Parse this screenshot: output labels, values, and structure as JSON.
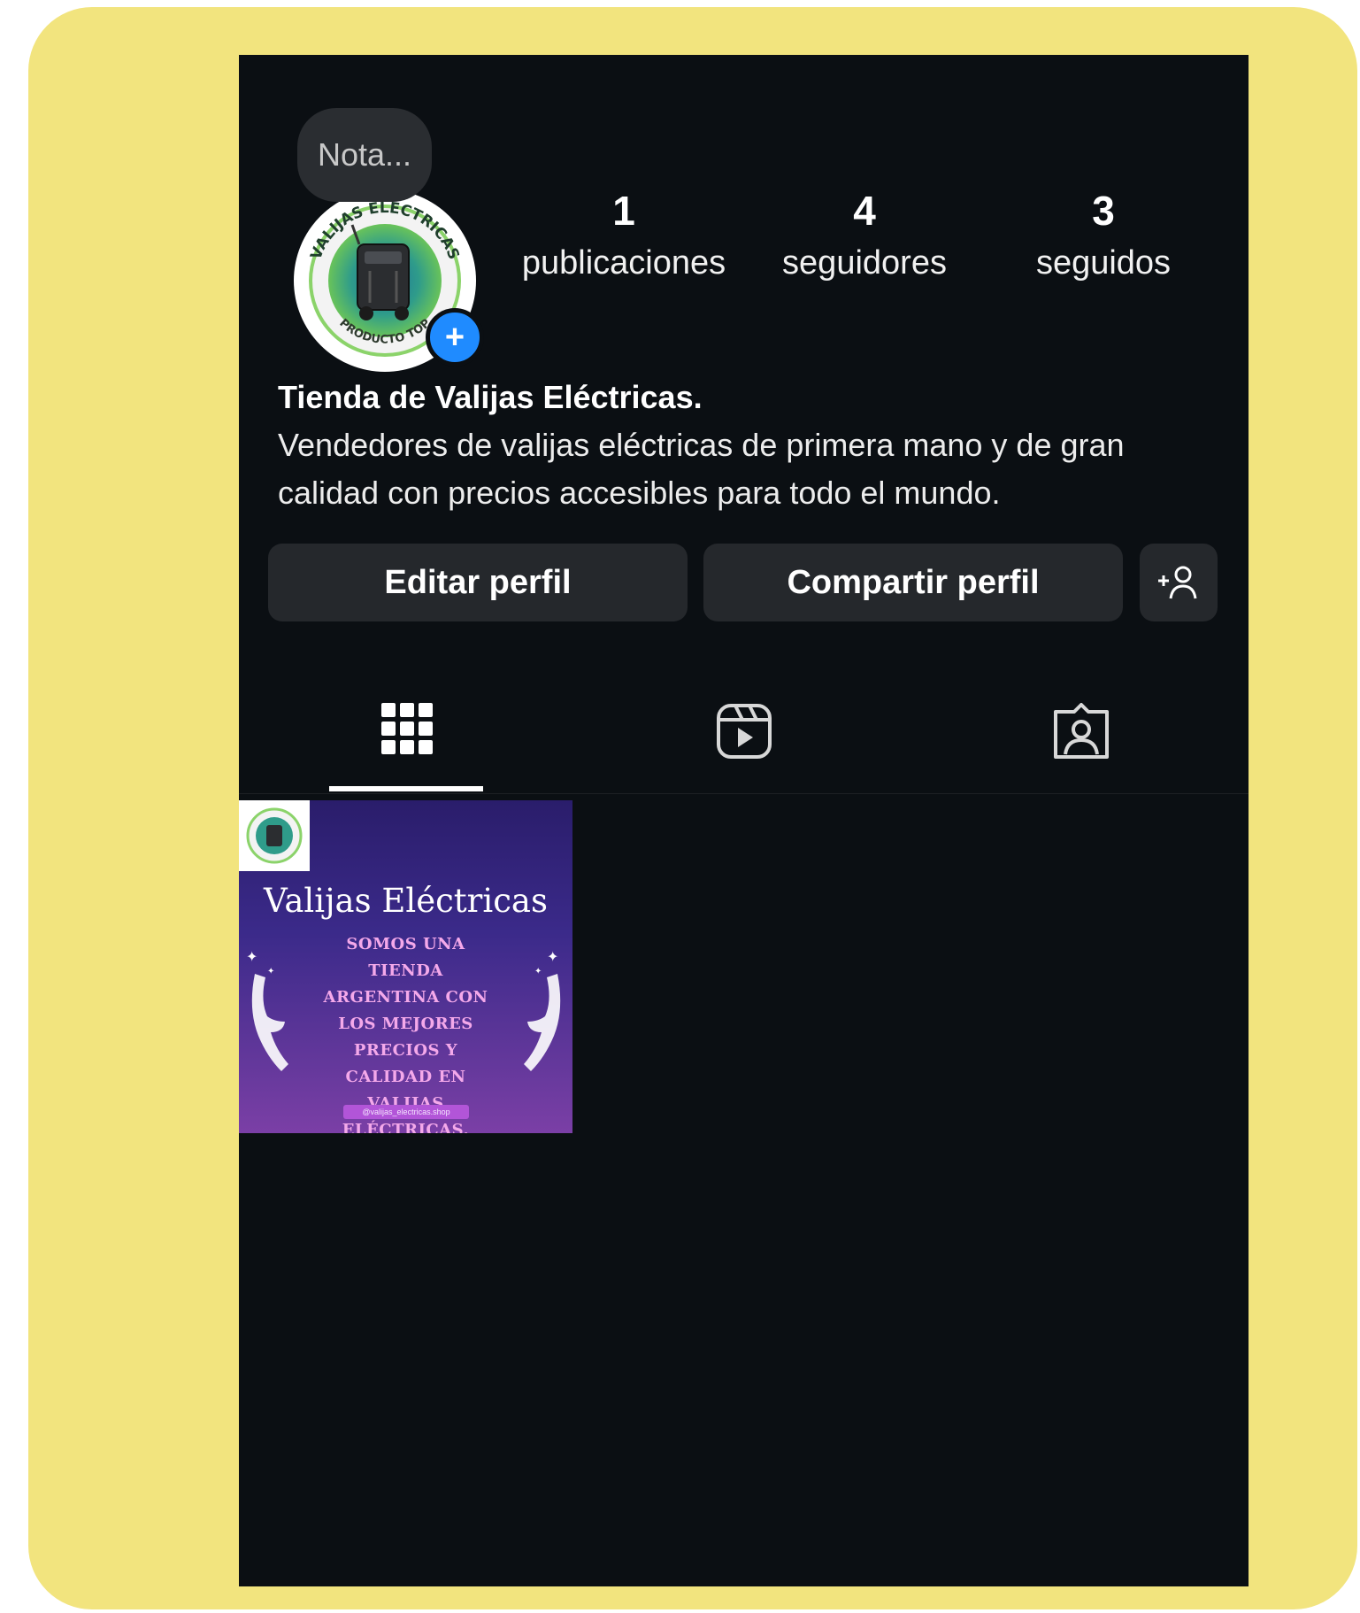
{
  "profile": {
    "note_placeholder": "Nota...",
    "avatar_alt": "Valijas Eléctricas logo",
    "avatar_text_top": "VALIJAS ELÉCTRICAS",
    "avatar_text_bottom": "PRODUCTO TOP",
    "stats": [
      {
        "count": "1",
        "label": "publicaciones"
      },
      {
        "count": "4",
        "label": "seguidores"
      },
      {
        "count": "3",
        "label": "seguidos"
      }
    ],
    "name": "Tienda de Valijas Eléctricas.",
    "bio": "Vendedores de valijas eléctricas de primera mano y de gran calidad con precios accesibles para todo el mundo."
  },
  "actions": {
    "edit_label": "Editar perfil",
    "share_label": "Compartir perfil"
  },
  "tabs": [
    {
      "icon": "grid-icon",
      "active": true
    },
    {
      "icon": "reels-icon",
      "active": false
    },
    {
      "icon": "tagged-icon",
      "active": false
    }
  ],
  "posts": [
    {
      "title": "Valijas Eléctricas",
      "text": "Somos una tienda argentina con los mejores precios y calidad en valijas eléctricas.",
      "handle": "@valijas_electricas.shop"
    }
  ],
  "colors": {
    "frame": "#f2e47e",
    "background": "#0b0f13",
    "button": "#25282c",
    "accent_blue": "#1f8bff",
    "post_text": "#f4a9ea"
  }
}
